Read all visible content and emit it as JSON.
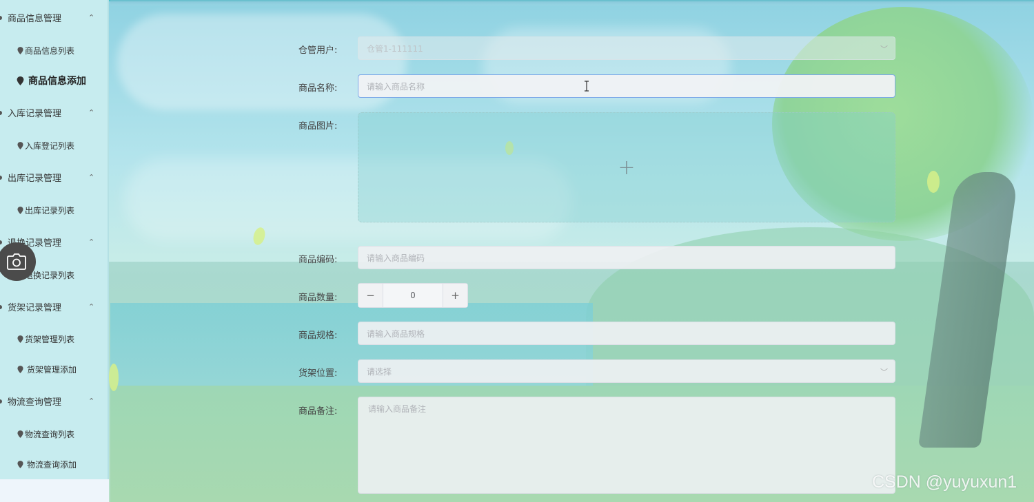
{
  "sidebar": {
    "groups": [
      {
        "label": "商品信息管理",
        "items": [
          {
            "label": "商品信息列表"
          },
          {
            "label": "商品信息添加",
            "active": true
          }
        ]
      },
      {
        "label": "入库记录管理",
        "items": [
          {
            "label": "入库登记列表"
          }
        ]
      },
      {
        "label": "出库记录管理",
        "items": [
          {
            "label": "出库记录列表"
          }
        ]
      },
      {
        "label": "退换记录管理",
        "items": [
          {
            "label": "退换记录列表"
          }
        ]
      },
      {
        "label": "货架记录管理",
        "items": [
          {
            "label": "货架管理列表"
          },
          {
            "label": "货架管理添加"
          }
        ]
      },
      {
        "label": "物流查询管理",
        "items": [
          {
            "label": "物流查询列表"
          },
          {
            "label": "物流查询添加"
          }
        ]
      }
    ],
    "chevron_icon": "chevron-up-icon",
    "item_icon": "map-pin-icon"
  },
  "form": {
    "warehouse_user": {
      "label": "仓管用户:",
      "value": "仓管1-111111"
    },
    "product_name": {
      "label": "商品名称:",
      "placeholder": "请输入商品名称"
    },
    "product_image": {
      "label": "商品图片:",
      "upload_icon": "plus-icon"
    },
    "product_code": {
      "label": "商品编码:",
      "placeholder": "请输入商品编码"
    },
    "product_quantity": {
      "label": "商品数量:",
      "value": "0",
      "minus": "−",
      "plus": "+"
    },
    "product_spec": {
      "label": "商品规格:",
      "placeholder": "请输入商品规格"
    },
    "shelf_location": {
      "label": "货架位置:",
      "placeholder": "请选择"
    },
    "product_remark": {
      "label": "商品备注:",
      "placeholder": "请输入商品备注"
    }
  },
  "floating_button": {
    "icon": "camera-icon"
  },
  "watermark": "CSDN @yuyuxun1",
  "colors": {
    "sidebar_bg": "#c7ecef",
    "accent": "#49c2c9",
    "focus_border": "#7aa7e8"
  }
}
